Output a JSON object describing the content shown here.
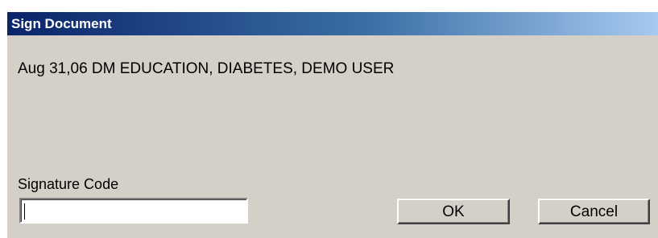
{
  "window": {
    "title": "Sign Document"
  },
  "document": {
    "line": "Aug 31,06  DM EDUCATION, DIABETES, DEMO USER"
  },
  "signature": {
    "label": "Signature Code",
    "value": ""
  },
  "buttons": {
    "ok_label": "OK",
    "cancel_label": "Cancel"
  },
  "colors": {
    "titlebar_start": "#0a246a",
    "titlebar_end": "#a6caf0",
    "dialog_background": "#d4d0c8"
  }
}
